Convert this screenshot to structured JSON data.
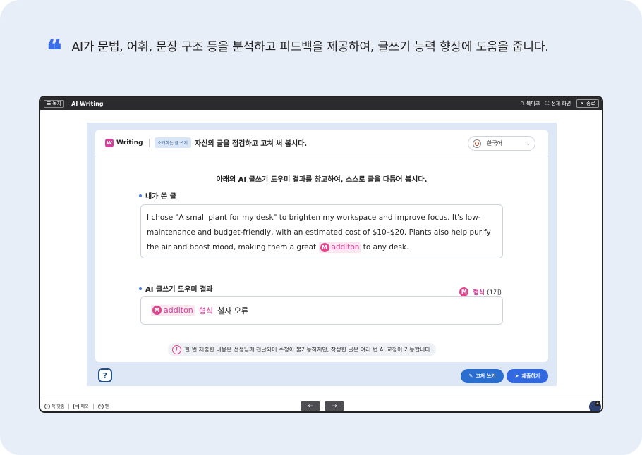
{
  "headline": {
    "quote_mark": "❝",
    "text": "AI가 문법, 어휘, 문장 구조 등을 분석하고 피드백을 제공하여, 글쓰기 능력 향상에 도움을 줍니다."
  },
  "topbar": {
    "list_label": "목차",
    "title": "AI Writing",
    "bookmark_label": "북마크",
    "fullscreen_label": "전체 화면",
    "close_label": "종료"
  },
  "panel": {
    "brand": "Writing",
    "brand_mark": "W",
    "tag": "소개하는 글 쓰기",
    "title": "자신의 글을 점검하고 고쳐 써 봅시다.",
    "language": "한국어"
  },
  "instruction": "아래의 AI 글쓰기 도우미 결과를 참고하여, 스스로 글을 다듬어 봅시다.",
  "my_writing": {
    "label": "내가 쓴 글",
    "text_before": "I chose \"A small plant for my desk\" to brighten my workspace and improve focus. It's low-maintenance and budget-friendly, with an estimated cost of $10–$20. Plants also help purify the air and boost mood, making them a great ",
    "error_badge": "M",
    "error_word": "additon",
    "text_after": " to any desk."
  },
  "ai_result": {
    "label": "AI 글쓰기 도우미 결과",
    "count_badge": "M",
    "count_label": "형식",
    "count_value": "(1개)",
    "item_badge": "M",
    "item_word": "additon",
    "item_type": "형식",
    "item_desc": "철자 오류"
  },
  "notice": {
    "icon": "!",
    "text": "한 번 제출한 내용은 선생님께 전달되어 수정이 불가능하지만, 작성한 글은 여러 번 AI 교정이 가능합니다."
  },
  "buttons": {
    "help": "?",
    "fix": "고쳐 쓰기",
    "submit": "제출하기"
  },
  "bottombar": {
    "item1": "쪽 맞춤",
    "item2": "메모",
    "item3": "펜",
    "prev": "←",
    "next": "→"
  },
  "colors": {
    "accent_blue": "#3269e0",
    "error_pink": "#d4409a",
    "background": "#e8eef8"
  }
}
